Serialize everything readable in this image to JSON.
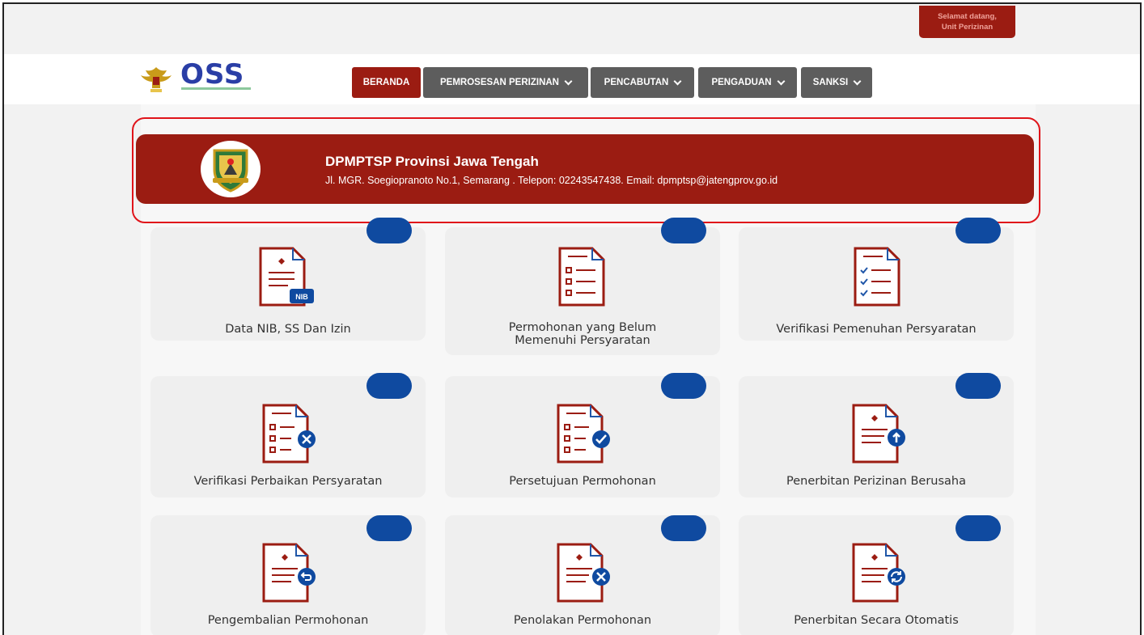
{
  "topbar": {
    "welcome_line1": "Selamat datang,",
    "welcome_line2": "Unit Perizinan"
  },
  "header": {
    "logo_text": "OSS",
    "nav": [
      {
        "label": "BERANDA",
        "dropdown": false
      },
      {
        "label": "PEMROSESAN PERIZINAN",
        "dropdown": true
      },
      {
        "label": "PENCABUTAN",
        "dropdown": true
      },
      {
        "label": "PENGADUAN",
        "dropdown": true
      },
      {
        "label": "SANKSI",
        "dropdown": true
      }
    ]
  },
  "banner": {
    "title": "DPMPTSP Provinsi Jawa Tengah",
    "subtitle": "Jl. MGR. Soegiopranoto No.1, Semarang . Telepon: 02243547438. Email: dpmptsp@jatengprov.go.id"
  },
  "cards": [
    {
      "label": "Data NIB, SS Dan Izin",
      "icon": "document-nib-icon"
    },
    {
      "label": "Permohonan yang Belum Memenuhi Persyaratan",
      "icon": "document-checklist-icon"
    },
    {
      "label": "Verifikasi Pemenuhan Persyaratan",
      "icon": "document-checked-list-icon"
    },
    {
      "label": "Verifikasi Perbaikan Persyaratan",
      "icon": "document-list-x-icon"
    },
    {
      "label": "Persetujuan Permohonan",
      "icon": "document-list-check-icon"
    },
    {
      "label": "Penerbitan Perizinan Berusaha",
      "icon": "document-upload-icon"
    },
    {
      "label": "Pengembalian Permohonan",
      "icon": "document-return-icon"
    },
    {
      "label": "Penolakan Permohonan",
      "icon": "document-reject-icon"
    },
    {
      "label": "Penerbitan Secara Otomatis",
      "icon": "document-auto-icon"
    }
  ],
  "colors": {
    "brand_red": "#9b1c12",
    "nav_gray": "#5d5d5d",
    "pill_blue": "#0f4aa0",
    "highlight_red": "#e0141a"
  }
}
